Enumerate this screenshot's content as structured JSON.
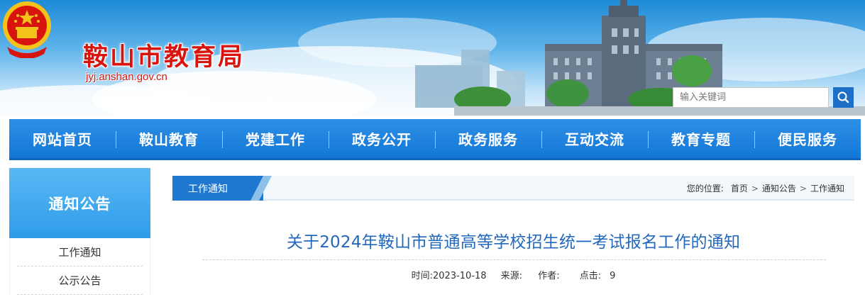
{
  "header": {
    "site_title": "鞍山市教育局",
    "site_domain": "jyj.anshan.gov.cn",
    "search_placeholder": "输入关键词"
  },
  "nav": {
    "items": [
      {
        "label": "网站首页"
      },
      {
        "label": "鞍山教育"
      },
      {
        "label": "党建工作"
      },
      {
        "label": "政务公开"
      },
      {
        "label": "政务服务"
      },
      {
        "label": "互动交流"
      },
      {
        "label": "教育专题"
      },
      {
        "label": "便民服务"
      }
    ]
  },
  "sidebar": {
    "heading": "通知公告",
    "items": [
      {
        "label": "工作通知"
      },
      {
        "label": "公示公告"
      }
    ]
  },
  "section": {
    "tab_label": "工作通知",
    "breadcrumb": {
      "prefix": "您的位置:",
      "items": [
        "首页",
        "通知公告",
        "工作通知"
      ],
      "separator": ">"
    }
  },
  "article": {
    "title": "关于2024年鞍山市普通高等学校招生统一考试报名工作的通知",
    "meta": {
      "time_label": "时间:",
      "time_value": "2023-10-18",
      "source_label": "来源:",
      "author_label": "作者:",
      "clicks_label": "点击:",
      "clicks_value": "9"
    }
  },
  "colors": {
    "brand_red": "#d8140e",
    "nav_blue": "#1f7fdb",
    "title_blue": "#2268bd",
    "sidebar_blue": "#3ea6ee"
  },
  "icons": {
    "emblem": "national-emblem-icon",
    "search": "search-icon"
  }
}
